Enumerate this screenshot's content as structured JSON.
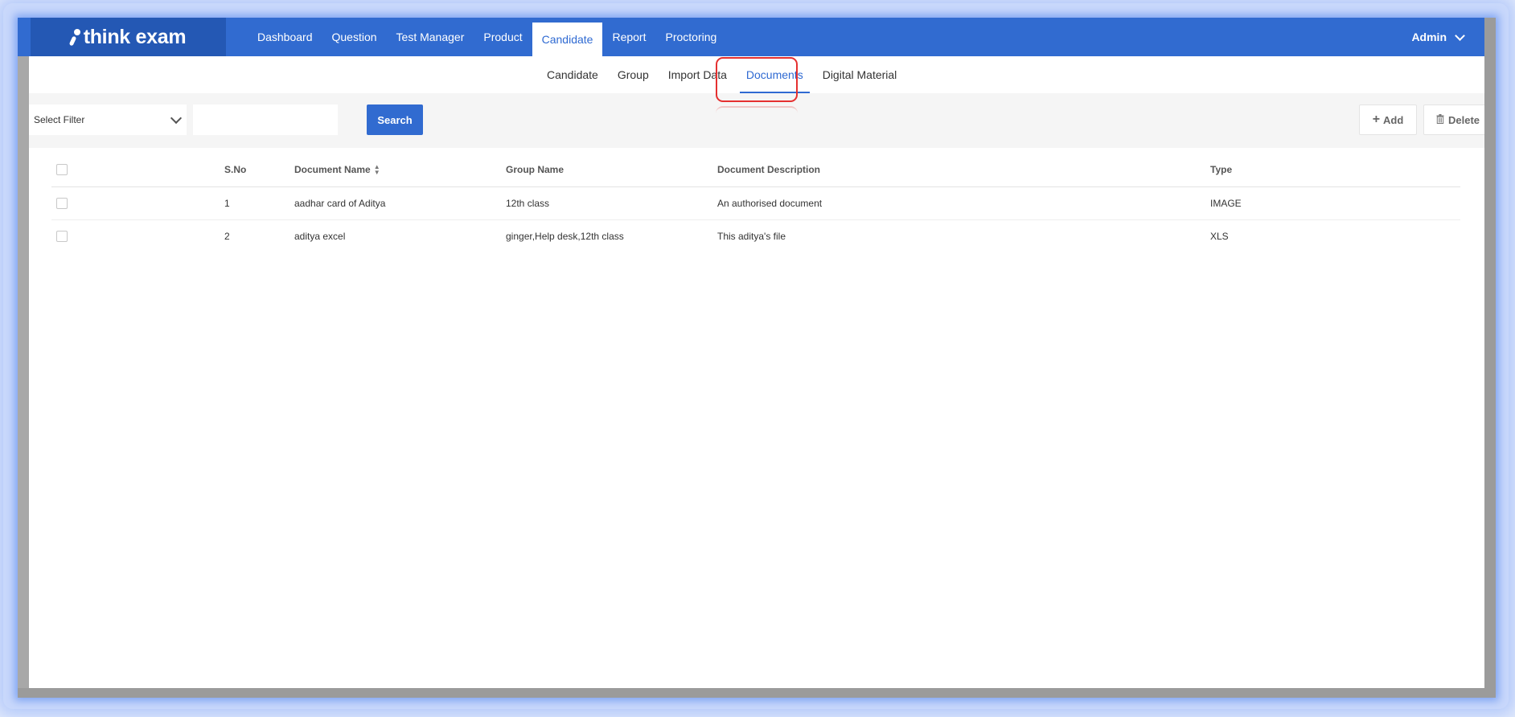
{
  "brand": {
    "name": "think exam"
  },
  "topnav": {
    "items": [
      {
        "label": "Dashboard",
        "active": false
      },
      {
        "label": "Question",
        "active": false
      },
      {
        "label": "Test Manager",
        "active": false
      },
      {
        "label": "Product",
        "active": false
      },
      {
        "label": "Candidate",
        "active": true
      },
      {
        "label": "Report",
        "active": false
      },
      {
        "label": "Proctoring",
        "active": false
      }
    ],
    "user_label": "Admin"
  },
  "subnav": {
    "items": [
      {
        "label": "Candidate",
        "active": false
      },
      {
        "label": "Group",
        "active": false
      },
      {
        "label": "Import Data",
        "active": false
      },
      {
        "label": "Documents",
        "active": true
      },
      {
        "label": "Digital Material",
        "active": false
      }
    ]
  },
  "toolbar": {
    "filter_label": "Select Filter",
    "search_value": "",
    "search_label": "Search",
    "add_label": "Add",
    "delete_label": "Delete"
  },
  "table": {
    "headers": {
      "sno": "S.No",
      "document_name": "Document Name",
      "group_name": "Group Name",
      "document_description": "Document Description",
      "type": "Type"
    },
    "rows": [
      {
        "sno": "1",
        "document_name": "aadhar card of Aditya",
        "group_name": "12th class",
        "document_description": "An authorised document",
        "type": "IMAGE"
      },
      {
        "sno": "2",
        "document_name": "aditya excel",
        "group_name": "ginger,Help desk,12th class",
        "document_description": "This aditya's file",
        "type": "XLS"
      }
    ]
  },
  "colors": {
    "primary": "#316bd0",
    "brand_bg": "#2458b4",
    "highlight": "#e53030"
  }
}
